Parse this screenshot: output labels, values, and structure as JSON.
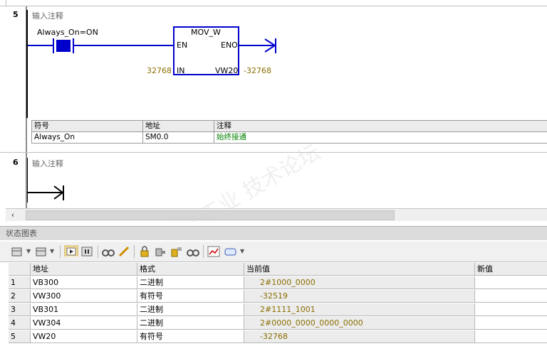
{
  "network5": {
    "number": "5",
    "comment": "输入注释",
    "contact_label": "Always_On=ON",
    "box": {
      "title": "MOV_W",
      "en": "EN",
      "eno": "ENO",
      "in": "IN",
      "out": "VW20",
      "in_value": "32768",
      "out_value": "-32768"
    },
    "symbol_table": {
      "headers": [
        "符号",
        "地址",
        "注释"
      ],
      "row": [
        "Always_On",
        "SM0.0",
        "始终接通"
      ]
    }
  },
  "network6": {
    "number": "6",
    "comment": "输入注释"
  },
  "status_chart": {
    "title": "状态图表",
    "headers": [
      "",
      "地址",
      "格式",
      "当前值",
      "新值"
    ],
    "rows": [
      {
        "n": "1",
        "addr": "VB300",
        "fmt": "二进制",
        "cur": "2#1000_0000",
        "new": ""
      },
      {
        "n": "2",
        "addr": "VW300",
        "fmt": "有符号",
        "cur": "-32519",
        "new": ""
      },
      {
        "n": "3",
        "addr": "VB301",
        "fmt": "二进制",
        "cur": "2#1111_1001",
        "new": ""
      },
      {
        "n": "4",
        "addr": "VW304",
        "fmt": "二进制",
        "cur": "2#0000_0000_0000_0000",
        "new": ""
      },
      {
        "n": "5",
        "addr": "VW20",
        "fmt": "有符号",
        "cur": "-32768",
        "new": ""
      }
    ]
  },
  "watermark": "西门子工业 技术论坛 support.industry.siemens.com/cs",
  "colors": {
    "rung": "#0000cc",
    "value": "#8a6d00",
    "comment_green": "#008000"
  }
}
